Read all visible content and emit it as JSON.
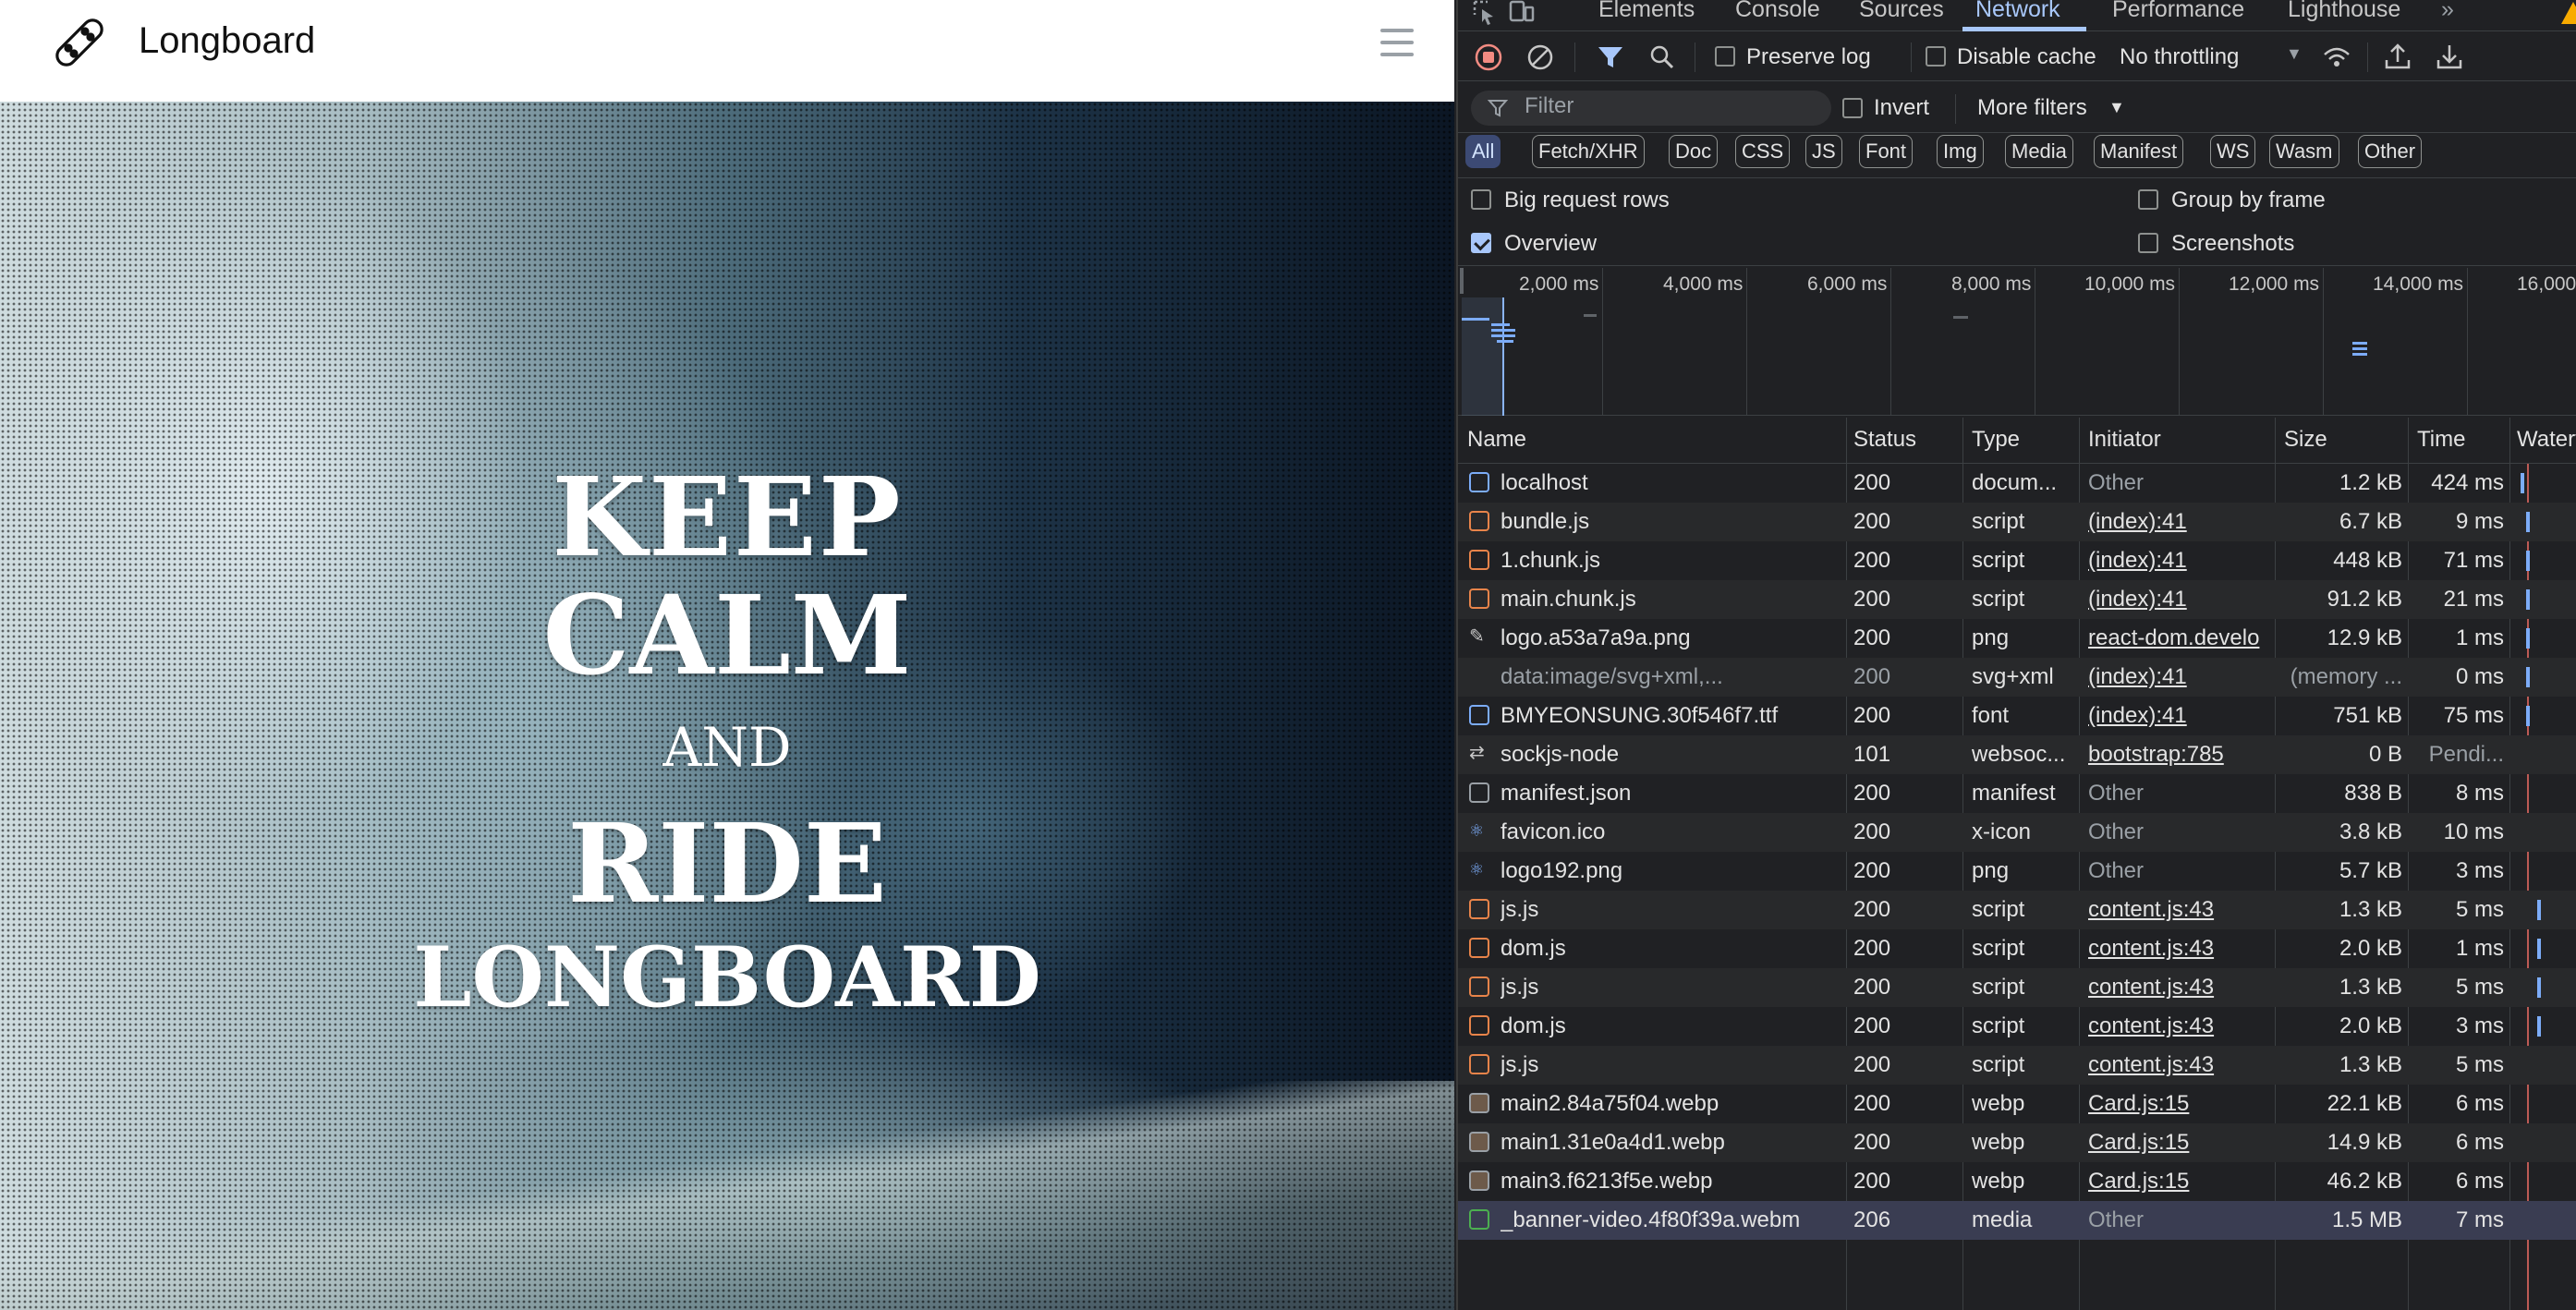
{
  "app": {
    "brand": "Longboard",
    "hero": {
      "line1": "KEEP",
      "line2": "CALM",
      "line3": "AND",
      "line4": "RIDE",
      "line5": "LONGBOARD"
    }
  },
  "devtools": {
    "tabs": [
      "Elements",
      "Console",
      "Sources",
      "Network",
      "Performance",
      "Lighthouse"
    ],
    "active_tab": "Network",
    "more_tabs_icon": "double-chevron-icon",
    "toolbar": {
      "preserve_log": "Preserve log",
      "disable_cache": "Disable cache",
      "throttling": "No throttling"
    },
    "filter": {
      "placeholder": "Filter",
      "invert": "Invert",
      "more_filters": "More filters"
    },
    "type_filters": [
      "All",
      "Fetch/XHR",
      "Doc",
      "CSS",
      "JS",
      "Font",
      "Img",
      "Media",
      "Manifest",
      "WS",
      "Wasm",
      "Other"
    ],
    "options": {
      "big_request_rows": "Big request rows",
      "group_by_frame": "Group by frame",
      "overview": "Overview",
      "screenshots": "Screenshots"
    },
    "overview_ticks": [
      "2,000 ms",
      "4,000 ms",
      "6,000 ms",
      "8,000 ms",
      "10,000 ms",
      "12,000 ms",
      "14,000 ms",
      "16,000"
    ],
    "columns": [
      "Name",
      "Status",
      "Type",
      "Initiator",
      "Size",
      "Time",
      "Waterfall"
    ],
    "requests": [
      {
        "name": "localhost",
        "status": "200",
        "type": "docum...",
        "initiator": "Other",
        "size": "1.2 kB",
        "time": "424 ms",
        "icon": "doc"
      },
      {
        "name": "bundle.js",
        "status": "200",
        "type": "script",
        "initiator": "(index):41",
        "size": "6.7 kB",
        "time": "9 ms",
        "icon": "script"
      },
      {
        "name": "1.chunk.js",
        "status": "200",
        "type": "script",
        "initiator": "(index):41",
        "size": "448 kB",
        "time": "71 ms",
        "icon": "script"
      },
      {
        "name": "main.chunk.js",
        "status": "200",
        "type": "script",
        "initiator": "(index):41",
        "size": "91.2 kB",
        "time": "21 ms",
        "icon": "script"
      },
      {
        "name": "logo.a53a7a9a.png",
        "status": "200",
        "type": "png",
        "initiator": "react-dom.develo",
        "size": "12.9 kB",
        "time": "1 ms",
        "icon": "pencil"
      },
      {
        "name": "data:image/svg+xml,...",
        "status": "200",
        "type": "svg+xml",
        "initiator": "(index):41",
        "size": "(memory ...",
        "time": "0 ms",
        "icon": "none"
      },
      {
        "name": "BMYEONSUNG.30f546f7.ttf",
        "status": "200",
        "type": "font",
        "initiator": "(index):41",
        "size": "751 kB",
        "time": "75 ms",
        "icon": "font"
      },
      {
        "name": "sockjs-node",
        "status": "101",
        "type": "websoc...",
        "initiator": "bootstrap:785",
        "size": "0 B",
        "time": "Pendi...",
        "icon": "ws"
      },
      {
        "name": "manifest.json",
        "status": "200",
        "type": "manifest",
        "initiator": "Other",
        "size": "838 B",
        "time": "8 ms",
        "icon": "manifest"
      },
      {
        "name": "favicon.ico",
        "status": "200",
        "type": "x-icon",
        "initiator": "Other",
        "size": "3.8 kB",
        "time": "10 ms",
        "icon": "react"
      },
      {
        "name": "logo192.png",
        "status": "200",
        "type": "png",
        "initiator": "Other",
        "size": "5.7 kB",
        "time": "3 ms",
        "icon": "react"
      },
      {
        "name": "js.js",
        "status": "200",
        "type": "script",
        "initiator": "content.js:43",
        "size": "1.3 kB",
        "time": "5 ms",
        "icon": "script"
      },
      {
        "name": "dom.js",
        "status": "200",
        "type": "script",
        "initiator": "content.js:43",
        "size": "2.0 kB",
        "time": "1 ms",
        "icon": "script"
      },
      {
        "name": "js.js",
        "status": "200",
        "type": "script",
        "initiator": "content.js:43",
        "size": "1.3 kB",
        "time": "5 ms",
        "icon": "script"
      },
      {
        "name": "dom.js",
        "status": "200",
        "type": "script",
        "initiator": "content.js:43",
        "size": "2.0 kB",
        "time": "3 ms",
        "icon": "script"
      },
      {
        "name": "js.js",
        "status": "200",
        "type": "script",
        "initiator": "content.js:43",
        "size": "1.3 kB",
        "time": "5 ms",
        "icon": "script"
      },
      {
        "name": "main2.84a75f04.webp",
        "status": "200",
        "type": "webp",
        "initiator": "Card.js:15",
        "size": "22.1 kB",
        "time": "6 ms",
        "icon": "img"
      },
      {
        "name": "main1.31e0a4d1.webp",
        "status": "200",
        "type": "webp",
        "initiator": "Card.js:15",
        "size": "14.9 kB",
        "time": "6 ms",
        "icon": "img"
      },
      {
        "name": "main3.f6213f5e.webp",
        "status": "200",
        "type": "webp",
        "initiator": "Card.js:15",
        "size": "46.2 kB",
        "time": "6 ms",
        "icon": "img"
      },
      {
        "name": "_banner-video.4f80f39a.webm",
        "status": "206",
        "type": "media",
        "initiator": "Other",
        "size": "1.5 MB",
        "time": "7 ms",
        "icon": "media"
      }
    ]
  }
}
